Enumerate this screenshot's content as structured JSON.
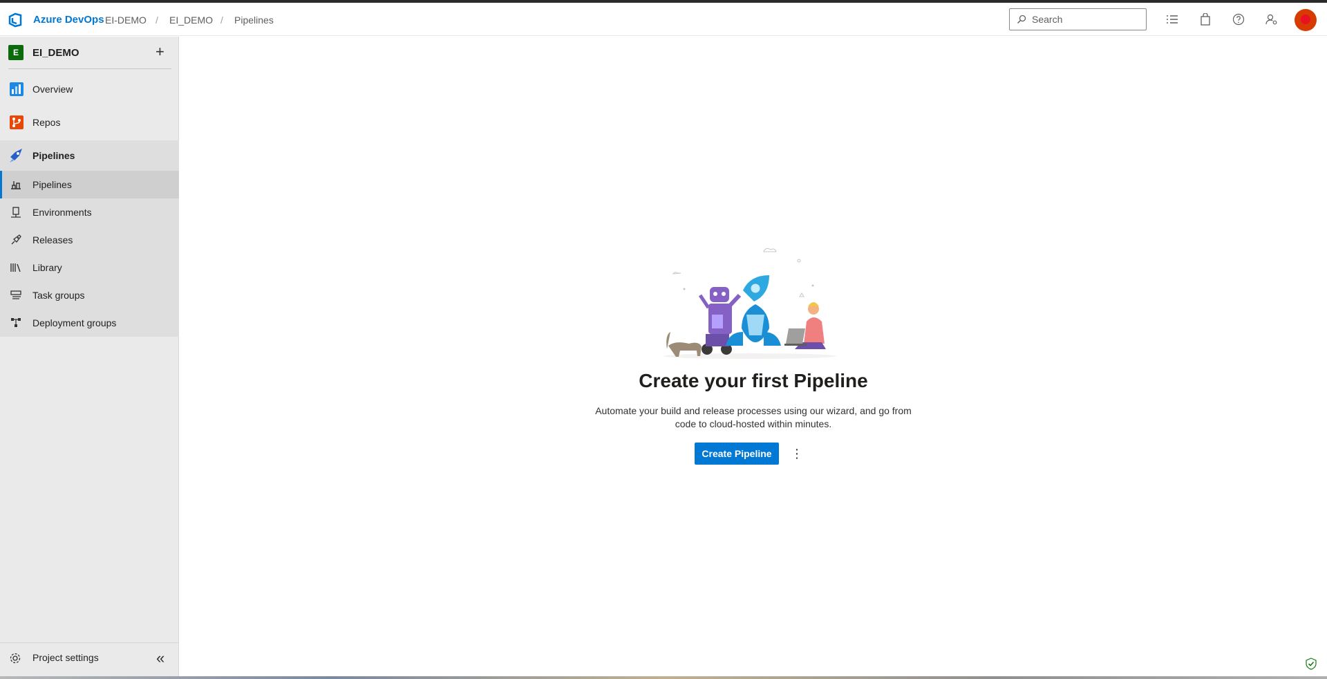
{
  "header": {
    "brand": "Azure DevOps",
    "breadcrumb": [
      "EI-DEMO",
      "EI_DEMO",
      "Pipelines"
    ],
    "separator": "/",
    "search_placeholder": "Search"
  },
  "project": {
    "initial": "E",
    "name": "EI_DEMO",
    "add_label": "+"
  },
  "sidebar": {
    "items": [
      {
        "label": "Overview",
        "icon": "overview-icon"
      },
      {
        "label": "Repos",
        "icon": "repos-icon"
      },
      {
        "label": "Pipelines",
        "icon": "pipelines-icon"
      }
    ],
    "subitems": [
      {
        "label": "Pipelines",
        "icon": "pipelines-sub-icon",
        "active": true
      },
      {
        "label": "Environments",
        "icon": "environments-icon"
      },
      {
        "label": "Releases",
        "icon": "releases-icon"
      },
      {
        "label": "Library",
        "icon": "library-icon"
      },
      {
        "label": "Task groups",
        "icon": "task-groups-icon"
      },
      {
        "label": "Deployment groups",
        "icon": "deployment-groups-icon"
      }
    ],
    "settings_label": "Project settings",
    "collapse_label": "«"
  },
  "main": {
    "title": "Create your first Pipeline",
    "description_line1": "Automate your build and release processes using our wizard, and go from",
    "description_line2": "code to cloud-hosted within minutes.",
    "create_button": "Create Pipeline",
    "more_label": "⋮"
  },
  "colors": {
    "accent": "#0078d4",
    "sidebar_bg": "#eaeaea",
    "avatar": "#d83b01"
  }
}
